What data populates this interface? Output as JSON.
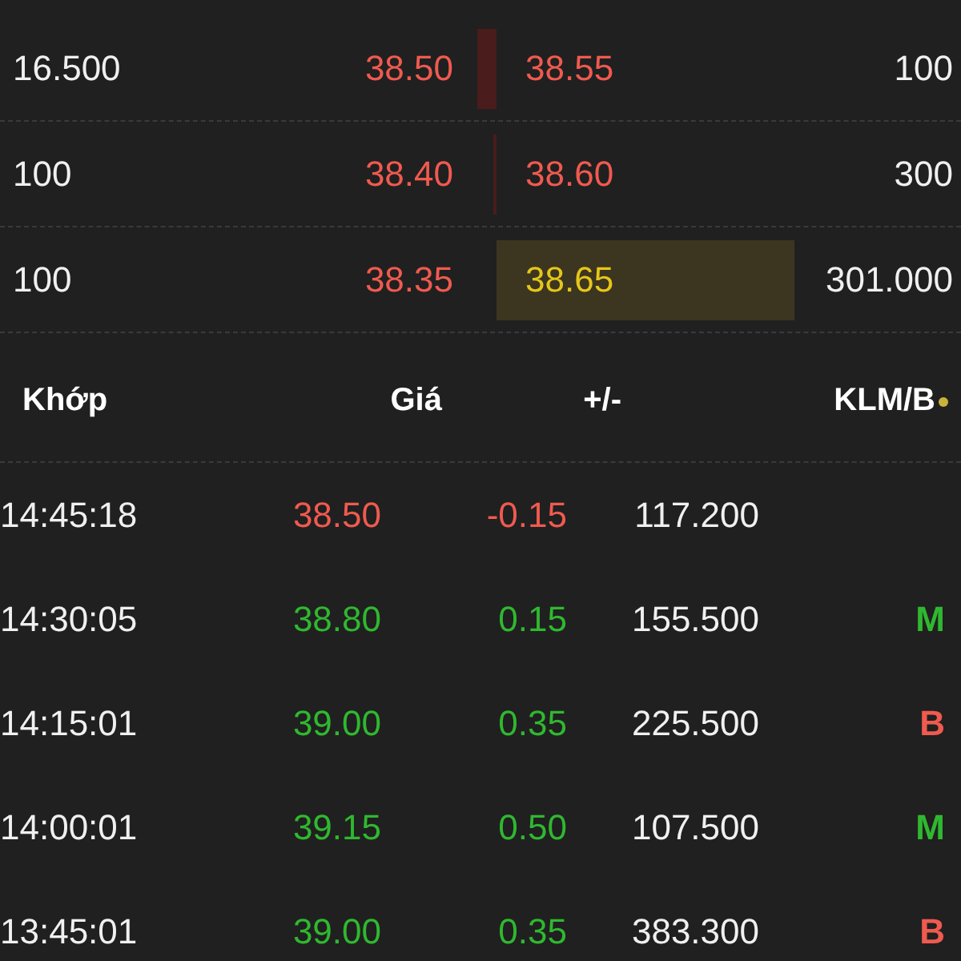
{
  "order_book": [
    {
      "bid": {
        "volume": "16.500",
        "price": "38.50",
        "kind": "bar"
      },
      "ask": {
        "price": "38.55",
        "volume": "100",
        "highlighted": false
      }
    },
    {
      "bid": {
        "volume": "100",
        "price": "38.40",
        "kind": "line"
      },
      "ask": {
        "price": "38.60",
        "volume": "300",
        "highlighted": false
      }
    },
    {
      "bid": {
        "volume": "100",
        "price": "38.35",
        "kind": "plain"
      },
      "ask": {
        "price": "38.65",
        "volume": "301.000",
        "highlighted": true
      }
    }
  ],
  "trades": {
    "columns": [
      "Khớp",
      "Giá",
      "+/-",
      "KLM/B"
    ],
    "rows": [
      {
        "time": "14:45:18",
        "price": "38.50",
        "change": "-0.15",
        "volume": "117.200",
        "kind": "down"
      },
      {
        "time": "14:30:05",
        "price": "38.80",
        "change": "0.15",
        "volume": "155.500",
        "kind": "up",
        "side": {
          "label": "M",
          "kind": "buy"
        }
      },
      {
        "time": "14:15:01",
        "price": "39.00",
        "change": "0.35",
        "volume": "225.500",
        "kind": "up",
        "side": {
          "label": "B",
          "kind": "sell"
        }
      },
      {
        "time": "14:00:01",
        "price": "39.15",
        "change": "0.50",
        "volume": "107.500",
        "kind": "up",
        "side": {
          "label": "M",
          "kind": "buy"
        }
      },
      {
        "time": "13:45:01",
        "price": "39.00",
        "change": "0.35",
        "volume": "383.300",
        "kind": "up",
        "side": {
          "label": "B",
          "kind": "sell"
        }
      }
    ]
  }
}
